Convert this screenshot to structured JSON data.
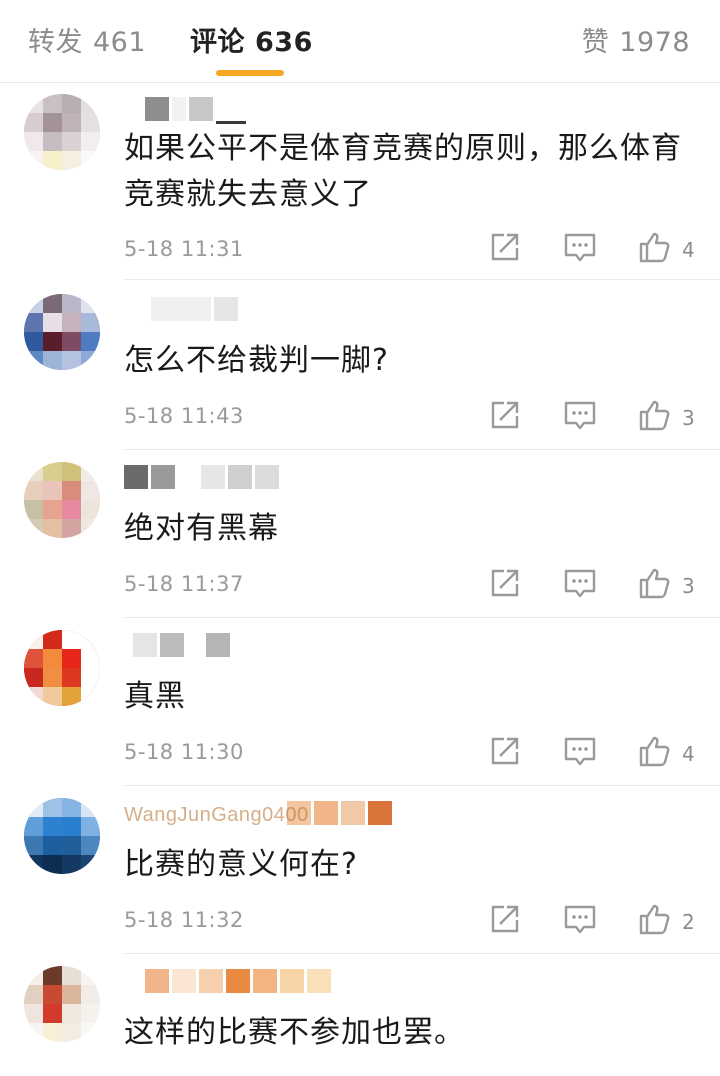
{
  "tabs": {
    "repost": {
      "label": "转发",
      "count": "461"
    },
    "comments": {
      "label": "评论",
      "count": "636"
    },
    "likes": {
      "label": "赞",
      "count": "1978"
    }
  },
  "colors": {
    "accent": "#f5a623",
    "text": "#1a1a1a",
    "muted": "#9a9a9a"
  },
  "icons": [
    "share-icon",
    "reply-icon",
    "like-icon"
  ],
  "comments": [
    {
      "username": "",
      "text": "如果公平不是体育竞赛的原则，那么体育竞赛就失去意义了",
      "time": "5-18 11:31",
      "likes": "4"
    },
    {
      "username": "",
      "text": "怎么不给裁判一脚?",
      "time": "5-18 11:43",
      "likes": "3"
    },
    {
      "username": "",
      "text": "绝对有黑幕",
      "time": "5-18 11:37",
      "likes": "3"
    },
    {
      "username": "",
      "text": "真黑",
      "time": "5-18 11:30",
      "likes": "4"
    },
    {
      "username": "WangJunGang0400",
      "text": "比赛的意义何在?",
      "time": "5-18 11:32",
      "likes": "2"
    },
    {
      "username": "",
      "text": "这样的比赛不参加也罢。",
      "time": "",
      "likes": ""
    }
  ]
}
